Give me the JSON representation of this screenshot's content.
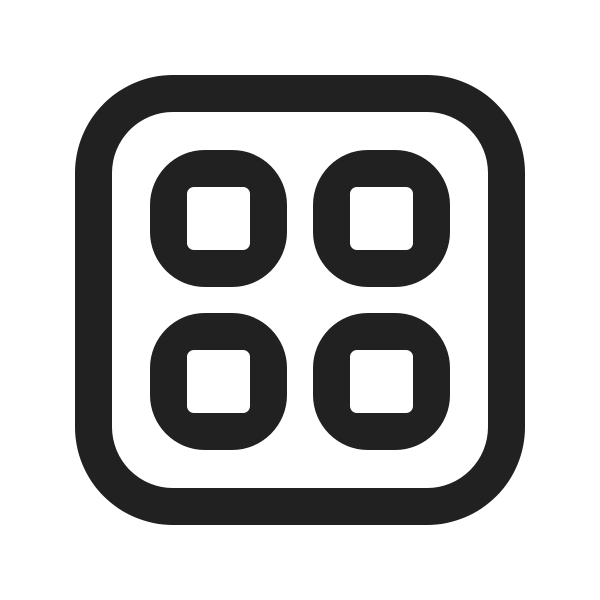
{
  "icon": {
    "name": "apps-grid-icon",
    "color": "#212121",
    "background": "#ffffff",
    "tiles": [
      "top-left",
      "top-right",
      "bottom-left",
      "bottom-right"
    ]
  }
}
